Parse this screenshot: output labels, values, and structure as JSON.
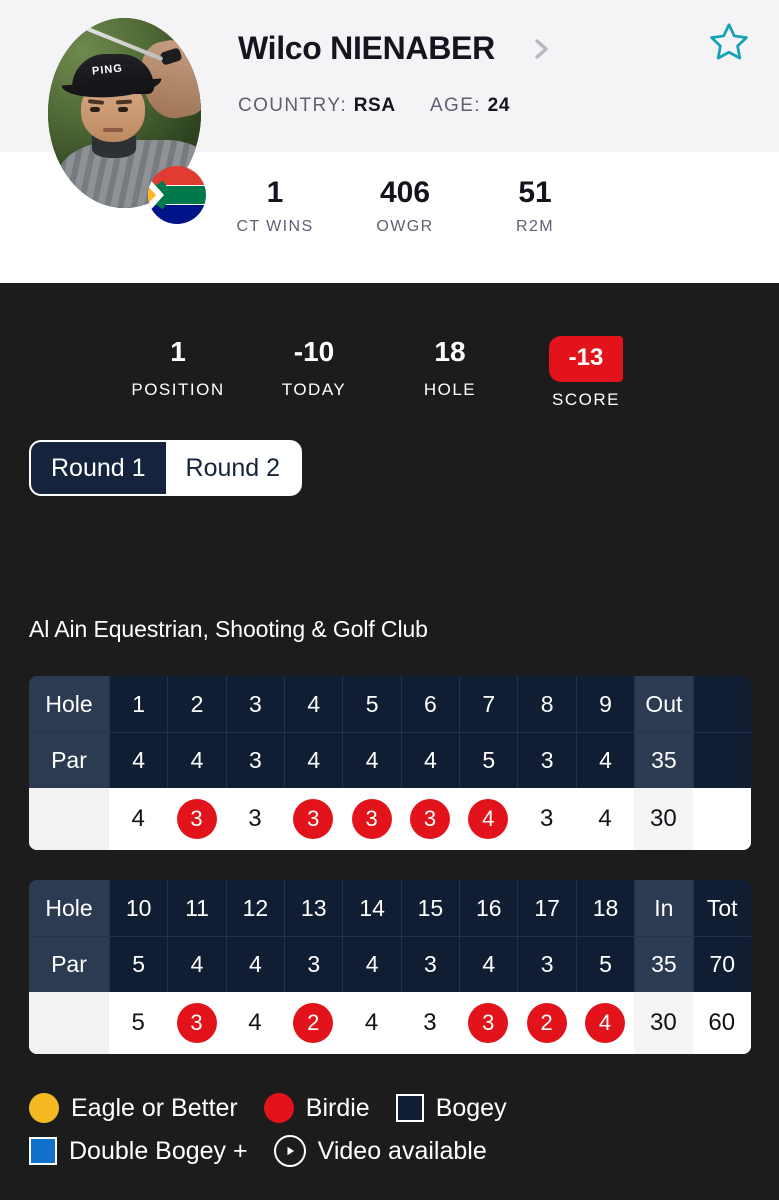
{
  "header": {
    "player_given_name": "Wilco",
    "player_family_name": "NIENABER",
    "chevron_icon": "chevron-right-icon",
    "country_label": "COUNTRY:",
    "country_value": "RSA",
    "age_label": "AGE:",
    "age_value": "24",
    "favorite_icon": "star-outline-icon",
    "flag_icon": "south-africa-flag-icon",
    "avatar_icon": "player-photo",
    "kpis": [
      {
        "value": "1",
        "label": "CT WINS"
      },
      {
        "value": "406",
        "label": "OWGR"
      },
      {
        "value": "51",
        "label": "R2M"
      }
    ]
  },
  "scorebar": [
    {
      "value": "1",
      "label": "POSITION"
    },
    {
      "value": "-10",
      "label": "TODAY"
    },
    {
      "value": "18",
      "label": "HOLE"
    },
    {
      "value": "-13",
      "label": "SCORE"
    }
  ],
  "round_tabs": [
    {
      "label": "Round 1",
      "selected": true
    },
    {
      "label": "Round 2",
      "selected": false
    }
  ],
  "venue": "Al Ain Equestrian, Shooting & Golf Club",
  "scorecard": {
    "row_labels": {
      "hole": "Hole",
      "par": "Par"
    },
    "front": {
      "holes": [
        "1",
        "2",
        "3",
        "4",
        "5",
        "6",
        "7",
        "8",
        "9"
      ],
      "aggregate_header": "Out",
      "par": [
        "4",
        "4",
        "3",
        "4",
        "4",
        "4",
        "5",
        "3",
        "4"
      ],
      "par_aggregate": "35",
      "scores": [
        "4",
        "3",
        "3",
        "3",
        "3",
        "3",
        "4",
        "3",
        "4"
      ],
      "score_types": [
        "par",
        "birdie",
        "par",
        "birdie",
        "birdie",
        "birdie",
        "birdie",
        "par",
        "par"
      ],
      "score_aggregate": "30"
    },
    "back": {
      "holes": [
        "10",
        "11",
        "12",
        "13",
        "14",
        "15",
        "16",
        "17",
        "18"
      ],
      "aggregate_header": "In",
      "total_header": "Tot",
      "par": [
        "5",
        "4",
        "4",
        "3",
        "4",
        "3",
        "4",
        "3",
        "5"
      ],
      "par_aggregate": "35",
      "par_total": "70",
      "scores": [
        "5",
        "3",
        "4",
        "2",
        "4",
        "3",
        "3",
        "2",
        "4"
      ],
      "score_types": [
        "par",
        "birdie",
        "par",
        "birdie",
        "par",
        "par",
        "birdie",
        "birdie",
        "birdie"
      ],
      "score_aggregate": "30",
      "score_total": "60"
    }
  },
  "legend": [
    {
      "label": "Eagle or Better",
      "icon": "eagle-circle-icon",
      "shape": "circle",
      "color": "#f5b921"
    },
    {
      "label": "Birdie",
      "icon": "birdie-circle-icon",
      "shape": "circle",
      "color": "#e2131a"
    },
    {
      "label": "Bogey",
      "icon": "bogey-square-icon",
      "shape": "square",
      "color": "#111d33"
    },
    {
      "label": "Double Bogey +",
      "icon": "double-bogey-square-icon",
      "shape": "square",
      "color": "#1072c8"
    },
    {
      "label": "Video available",
      "icon": "play-circle-icon",
      "shape": "play",
      "color": "#ffffff"
    }
  ],
  "colors": {
    "accent_red": "#e2131a",
    "navy": "#111d33",
    "slate": "#2c3a52",
    "dark_bg": "#1c1c1c",
    "star_teal": "#18a0b4",
    "eagle_yellow": "#f5b921",
    "double_bogey_blue": "#1072c8"
  }
}
